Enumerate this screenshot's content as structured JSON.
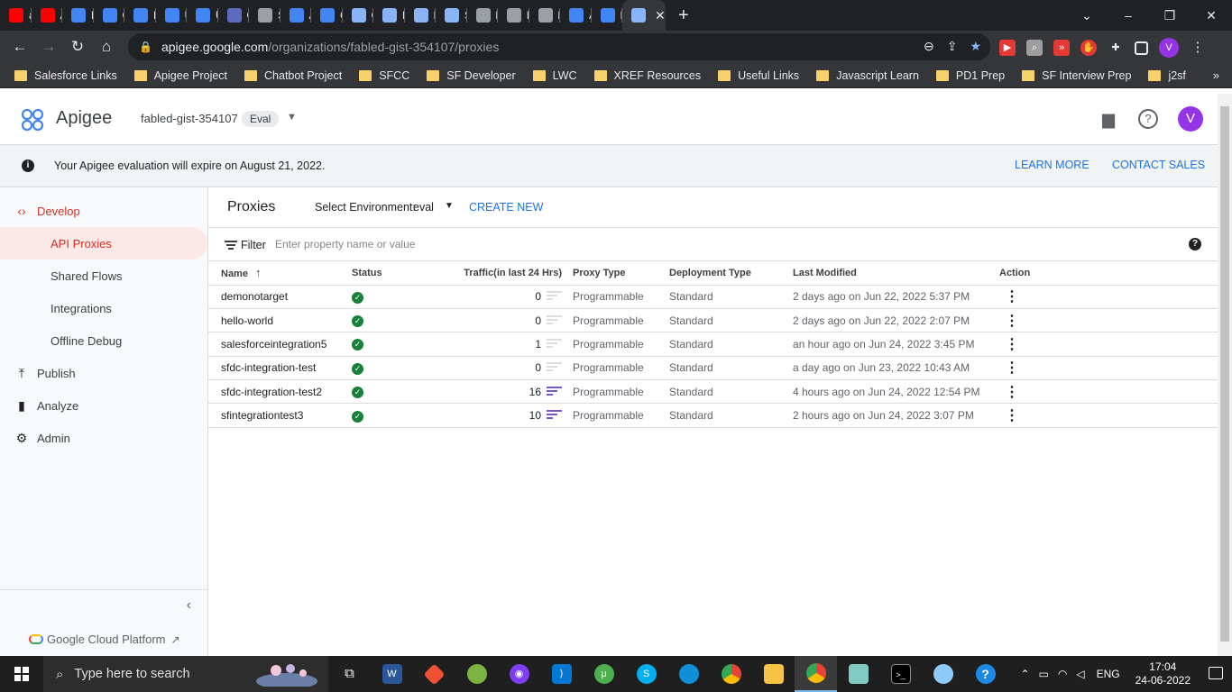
{
  "browser": {
    "tabs": [
      {
        "label": "ap",
        "icon": "youtube-icon",
        "color": "#ff0000"
      },
      {
        "label": "AF",
        "icon": "youtube-icon",
        "color": "#ff0000"
      },
      {
        "label": "Pr",
        "icon": "google-cloud-icon",
        "color": "#4285f4"
      },
      {
        "label": "Cr",
        "icon": "google-cloud-icon",
        "color": "#4285f4"
      },
      {
        "label": "Pr",
        "icon": "google-cloud-icon",
        "color": "#4285f4"
      },
      {
        "label": "Us",
        "icon": "google-cloud-icon",
        "color": "#4285f4"
      },
      {
        "label": "Us",
        "icon": "google-cloud-icon",
        "color": "#4285f4"
      },
      {
        "label": "Ce",
        "icon": "sitemap-icon",
        "color": "#5c6bc0"
      },
      {
        "label": "Sa",
        "icon": "globe-icon",
        "color": "#9aa0a6"
      },
      {
        "label": "All",
        "icon": "google-cloud-icon",
        "color": "#4285f4"
      },
      {
        "label": "Cr",
        "icon": "google-cloud-icon",
        "color": "#4285f4"
      },
      {
        "label": "Cc",
        "icon": "apigee-icon",
        "color": "#8ab4f8"
      },
      {
        "label": "En",
        "icon": "apigee-icon",
        "color": "#8ab4f8"
      },
      {
        "label": "Da",
        "icon": "grid-icon",
        "color": "#8ab4f8"
      },
      {
        "label": "Se",
        "icon": "apigee-icon",
        "color": "#8ab4f8"
      },
      {
        "label": "htt",
        "icon": "globe-icon",
        "color": "#9aa0a6"
      },
      {
        "label": "htt",
        "icon": "globe-icon",
        "color": "#9aa0a6"
      },
      {
        "label": "htt",
        "icon": "globe-icon",
        "color": "#9aa0a6"
      },
      {
        "label": "Ap",
        "icon": "docs-icon",
        "color": "#4285f4"
      },
      {
        "label": "Pr",
        "icon": "docs-icon",
        "color": "#4285f4"
      }
    ],
    "new_tab": "+",
    "url_host": "apigee.google.com",
    "url_path": "/organizations/fabled-gist-354107/proxies",
    "profile_initial": "V",
    "bookmarks": [
      "Salesforce Links",
      "Apigee Project",
      "Chatbot Project",
      "SFCC",
      "SF Developer",
      "LWC",
      "XREF Resources",
      "Useful Links",
      "Javascript Learn",
      "PD1 Prep",
      "SF Interview Prep",
      "j2sf"
    ]
  },
  "header": {
    "brand": "Apigee",
    "org": "fabled-gist-354107",
    "badge": "Eval",
    "avatar_initial": "V"
  },
  "banner": {
    "message": "Your Apigee evaluation will expire on August 21, 2022.",
    "learn_more": "LEARN MORE",
    "contact_sales": "CONTACT SALES"
  },
  "sidebar": {
    "develop": "Develop",
    "items": [
      "API Proxies",
      "Shared Flows",
      "Integrations",
      "Offline Debug"
    ],
    "publish": "Publish",
    "analyze": "Analyze",
    "admin": "Admin",
    "footer": "Google Cloud Platform"
  },
  "main": {
    "title": "Proxies",
    "env_label": "Select Environment:",
    "env_value": "eval",
    "create_new": "CREATE NEW",
    "filter_label": "Filter",
    "filter_placeholder": "Enter property name or value",
    "columns": {
      "name": "Name",
      "status": "Status",
      "traffic": "Traffic(in last 24 Hrs)",
      "type": "Proxy Type",
      "deploy": "Deployment Type",
      "modified": "Last Modified",
      "action": "Action"
    },
    "rows": [
      {
        "name": "demonotarget",
        "traffic": "0",
        "type": "Programmable",
        "deploy": "Standard",
        "modified": "2 days ago on Jun 22, 2022 5:37 PM"
      },
      {
        "name": "hello-world",
        "traffic": "0",
        "type": "Programmable",
        "deploy": "Standard",
        "modified": "2 days ago on Jun 22, 2022 2:07 PM"
      },
      {
        "name": "salesforceintegration5",
        "traffic": "1",
        "type": "Programmable",
        "deploy": "Standard",
        "modified": "an hour ago on Jun 24, 2022 3:45 PM"
      },
      {
        "name": "sfdc-integration-test",
        "traffic": "0",
        "type": "Programmable",
        "deploy": "Standard",
        "modified": "a day ago on Jun 23, 2022 10:43 AM"
      },
      {
        "name": "sfdc-integration-test2",
        "traffic": "16",
        "type": "Programmable",
        "deploy": "Standard",
        "modified": "4 hours ago on Jun 24, 2022 12:54 PM"
      },
      {
        "name": "sfintegrationtest3",
        "traffic": "10",
        "type": "Programmable",
        "deploy": "Standard",
        "modified": "2 hours ago on Jun 24, 2022 3:07 PM"
      }
    ]
  },
  "taskbar": {
    "search_placeholder": "Type here to search",
    "language": "ENG",
    "time": "17:04",
    "date": "24-06-2022"
  },
  "colors": {
    "accent_red": "#d93025",
    "link_blue": "#1a73e8",
    "status_green": "#188038",
    "traffic_purple": "#7e57c2"
  }
}
